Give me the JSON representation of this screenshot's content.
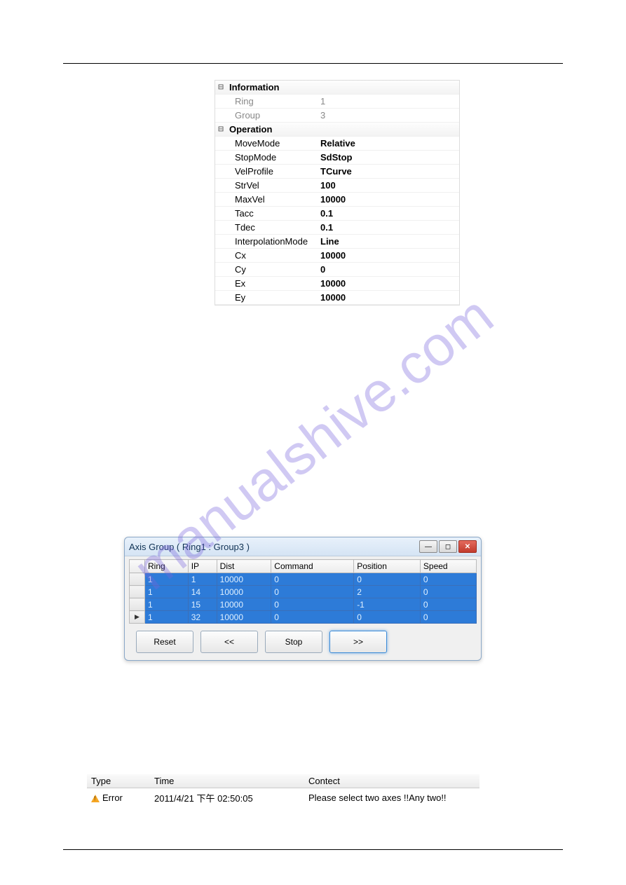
{
  "watermark": "manualshive.com",
  "props": {
    "section_info": "Information",
    "ring_label": "Ring",
    "ring_value": "1",
    "group_label": "Group",
    "group_value": "3",
    "section_op": "Operation",
    "movemode_label": "MoveMode",
    "movemode_value": "Relative",
    "stopmode_label": "StopMode",
    "stopmode_value": "SdStop",
    "velprofile_label": "VelProfile",
    "velprofile_value": "TCurve",
    "strvel_label": "StrVel",
    "strvel_value": "100",
    "maxvel_label": "MaxVel",
    "maxvel_value": "10000",
    "tacc_label": "Tacc",
    "tacc_value": "0.1",
    "tdec_label": "Tdec",
    "tdec_value": "0.1",
    "interp_label": "InterpolationMode",
    "interp_value": "Line",
    "cx_label": "Cx",
    "cx_value": "10000",
    "cy_label": "Cy",
    "cy_value": "0",
    "ex_label": "Ex",
    "ex_value": "10000",
    "ey_label": "Ey",
    "ey_value": "10000"
  },
  "axisWindow": {
    "title": "Axis Group ( Ring1 : Group3 )",
    "columns": {
      "col0": "",
      "ring": "Ring",
      "ip": "IP",
      "dist": "Dist",
      "command": "Command",
      "position": "Position",
      "speed": "Speed"
    },
    "rows": [
      {
        "ring": "1",
        "ip": "1",
        "dist": "10000",
        "command": "0",
        "position": "0",
        "speed": "0"
      },
      {
        "ring": "1",
        "ip": "14",
        "dist": "10000",
        "command": "0",
        "position": "2",
        "speed": "0"
      },
      {
        "ring": "1",
        "ip": "15",
        "dist": "10000",
        "command": "0",
        "position": "-1",
        "speed": "0"
      },
      {
        "ring": "1",
        "ip": "32",
        "dist": "10000",
        "command": "0",
        "position": "0",
        "speed": "0"
      }
    ],
    "buttons": {
      "reset": "Reset",
      "prev": "<<",
      "stop": "Stop",
      "next": ">>"
    }
  },
  "log": {
    "columns": {
      "type": "Type",
      "time": "Time",
      "content": "Contect"
    },
    "row": {
      "type": "Error",
      "time": "2011/4/21 下午 02:50:05",
      "content": "Please select two axes !!Any two!!"
    }
  }
}
